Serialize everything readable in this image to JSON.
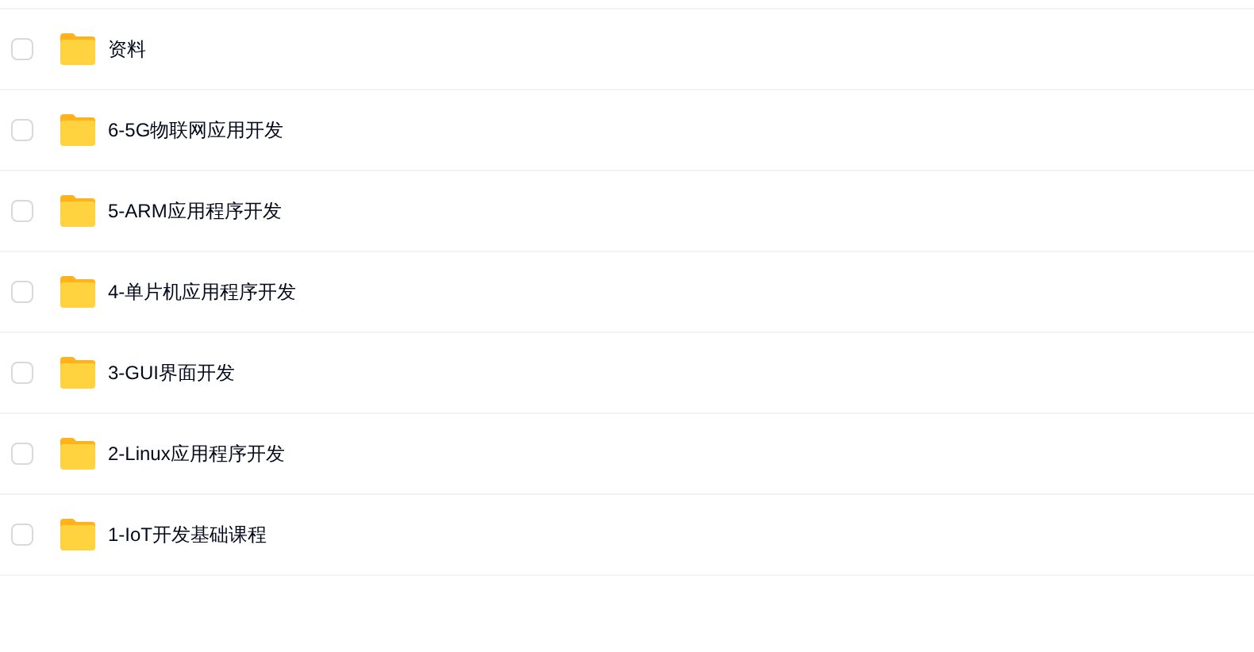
{
  "files": [
    {
      "name": "资料",
      "checked": false
    },
    {
      "name": "6-5G物联网应用开发",
      "checked": false
    },
    {
      "name": "5-ARM应用程序开发",
      "checked": false
    },
    {
      "name": "4-单片机应用程序开发",
      "checked": false
    },
    {
      "name": "3-GUI界面开发",
      "checked": false
    },
    {
      "name": "2-Linux应用程序开发",
      "checked": false
    },
    {
      "name": "1-IoT开发基础课程",
      "checked": false
    }
  ]
}
